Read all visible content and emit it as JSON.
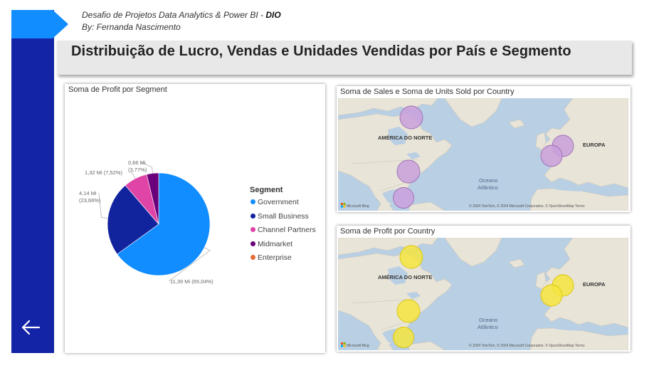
{
  "header": {
    "line1_prefix": "Desafio de Projetos Data Analytics & Power BI - ",
    "line1_brand": "DIO",
    "line2": "By: Fernanda Nascimento",
    "title": "Distribuição de Lucro, Vendas e Unidades Vendidas por País e Segmento"
  },
  "pie_card": {
    "title": "Soma de Profit por Segment",
    "legend_title": "Segment"
  },
  "chart_data": {
    "type": "pie",
    "legend_title": "Segment",
    "slices": [
      {
        "name": "Government",
        "value": 11.39,
        "label": "11,39 Mi (65,04%)",
        "percent": 65.04,
        "color": "#118dff"
      },
      {
        "name": "Small Business",
        "value": 4.14,
        "label": "4,14 Mi",
        "label2": "(23,66%)",
        "percent": 23.66,
        "color": "#12239e"
      },
      {
        "name": "Channel Partners",
        "value": 1.32,
        "label": "1,32 Mi (7,52%)",
        "percent": 7.52,
        "color": "#e044a7"
      },
      {
        "name": "Midmarket",
        "value": 0.66,
        "label": "0,66 Mi",
        "label2": "(3,77%)",
        "percent": 3.77,
        "color": "#6b007b"
      },
      {
        "name": "Enterprise",
        "value": 0.0,
        "label": "",
        "percent": 0.0,
        "color": "#e66c37"
      }
    ]
  },
  "map_sales": {
    "title": "Soma de Sales e Soma de Units Sold por Country",
    "bubble_color": "#c9a0dc",
    "bubble_stroke": "#9b6fb5"
  },
  "map_profit": {
    "title": "Soma de Profit por Country",
    "bubble_color": "#f5e53f",
    "bubble_stroke": "#d8c40a"
  },
  "map_labels": {
    "north_america": "AMÉRICA DO NORTE",
    "europe": "EUROPA",
    "ocean_line1": "Oceano",
    "ocean_line2": "Atlântico",
    "bing": "Microsoft Bing",
    "copyright": "© 2024 TomTom, © 2024 Microsoft Corporation, © OpenStreetMap  Terms"
  },
  "icons": {
    "back": "arrow-left-icon",
    "bing": "microsoft-logo-icon"
  }
}
